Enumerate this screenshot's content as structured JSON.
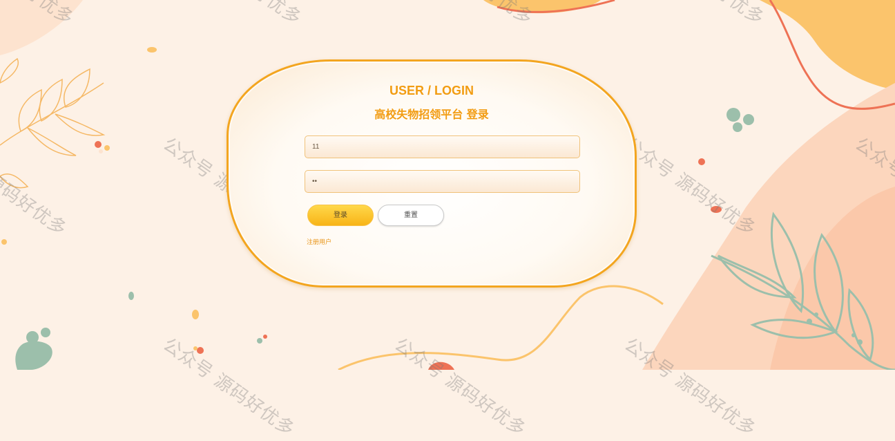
{
  "login": {
    "title": "USER / LOGIN",
    "subtitle": "高校失物招领平台 登录",
    "username_value": "11",
    "password_value": "••",
    "login_button": "登录",
    "reset_button": "重置",
    "register_link": "注册用户"
  },
  "watermark": {
    "text": "公众号 源码好优多"
  },
  "colors": {
    "accent": "#f29c12",
    "background": "#fdf1e6",
    "leaf": "#9cbfab",
    "blob_orange": "#fbc46c",
    "line_red": "#ee7255"
  }
}
